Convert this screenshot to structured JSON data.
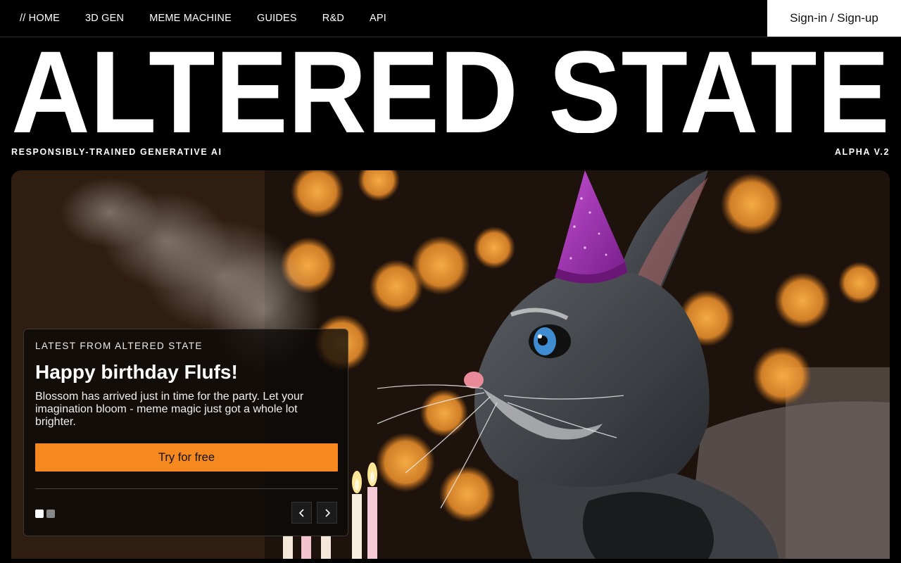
{
  "nav": {
    "items": [
      {
        "label": "// HOME"
      },
      {
        "label": "3D GEN"
      },
      {
        "label": "MEME MACHINE"
      },
      {
        "label": "GUIDES"
      },
      {
        "label": "R&D"
      },
      {
        "label": "API"
      }
    ],
    "signin": "Sign-in / Sign-up"
  },
  "brand": {
    "logo_text": "ALTERED STATE",
    "tagline": "RESPONSIBLY-TRAINED GENERATIVE AI",
    "version": "ALPHA V.2"
  },
  "hero": {
    "image": "birthday-bunny-with-party-hat-and-candles",
    "card": {
      "eyebrow": "LATEST FROM ALTERED STATE",
      "title": "Happy birthday Flufs!",
      "body": "Blossom has arrived just in time for the party. Let your imagination bloom - meme magic just got a whole lot brighter.",
      "cta": "Try for free"
    },
    "carousel": {
      "slide_count": 2,
      "active_slide": 1
    }
  },
  "colors": {
    "accent": "#f5891f",
    "background": "#000000",
    "text": "#ffffff"
  },
  "icons": [
    "chevron-left-icon",
    "chevron-right-icon"
  ]
}
